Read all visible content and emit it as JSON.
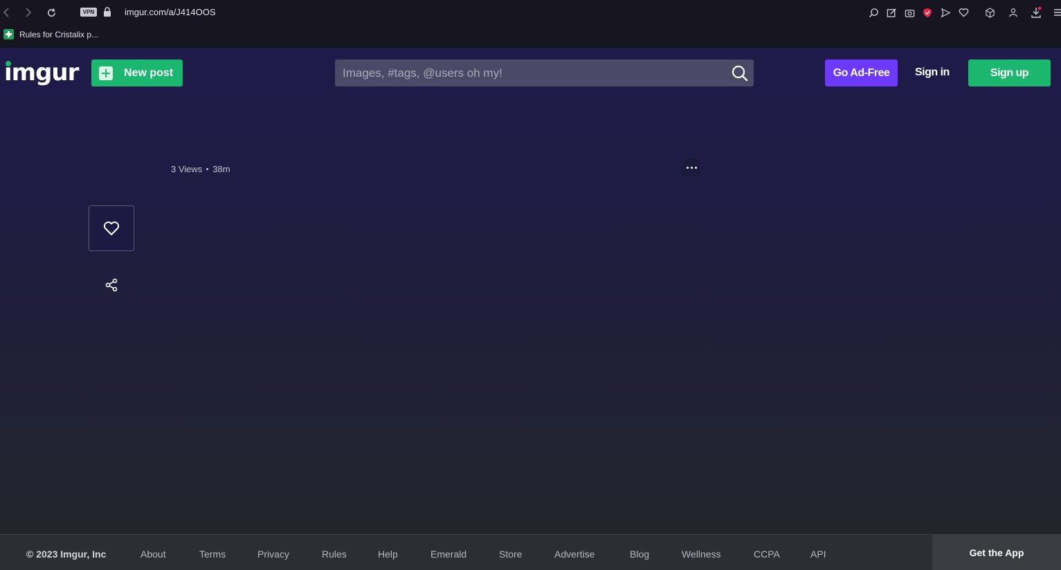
{
  "browser": {
    "url": "imgur.com/a/J414OOS",
    "vpn_label": "VPN",
    "bookmark": "Rules for Cristalix p..."
  },
  "header": {
    "logo": "imgur",
    "new_post": "New post",
    "search_placeholder": "Images, #tags, @users oh my!",
    "go_ad_free": "Go Ad-Free",
    "sign_in": "Sign in",
    "sign_up": "Sign up"
  },
  "post": {
    "views": "3 Views",
    "age": "38m"
  },
  "footer": {
    "copyright": "© 2023 Imgur, Inc",
    "links": [
      "About",
      "Terms",
      "Privacy",
      "Rules",
      "Help",
      "Emerald",
      "Store",
      "Advertise",
      "Blog",
      "Wellness",
      "CCPA",
      "API"
    ],
    "get_app": "Get the App"
  },
  "colors": {
    "brand_green": "#1bb76e",
    "ad_free_purple": "#6d3afc"
  }
}
